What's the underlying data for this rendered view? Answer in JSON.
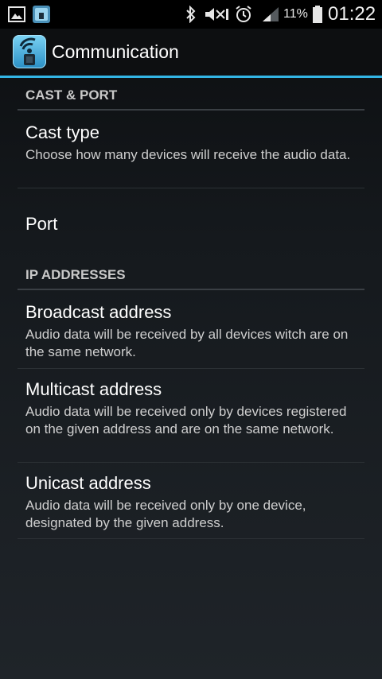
{
  "status_bar": {
    "battery_percent": "11%",
    "time": "01:22",
    "icons": [
      "picture-notification-icon",
      "app-notification-icon",
      "bluetooth-icon",
      "mute-icon",
      "alarm-icon",
      "signal-icon",
      "battery-icon"
    ]
  },
  "action_bar": {
    "title": "Communication"
  },
  "sections": [
    {
      "header": "CAST & PORT",
      "items": [
        {
          "title": "Cast type",
          "summary": "Choose how many devices will receive the audio data."
        },
        {
          "title": "Port",
          "summary": ""
        }
      ]
    },
    {
      "header": "IP ADDRESSES",
      "items": [
        {
          "title": "Broadcast address",
          "summary": "Audio data will be received by all devices witch are on the same network."
        },
        {
          "title": "Multicast address",
          "summary": "Audio data will be received only by devices registered on the given address and are on the same network."
        },
        {
          "title": "Unicast address",
          "summary": "Audio data will be received only by one device, designated by the given address."
        }
      ]
    }
  ],
  "colors": {
    "accent": "#33b5e5",
    "background": "#15191d",
    "header_text": "#c9c9c9"
  }
}
